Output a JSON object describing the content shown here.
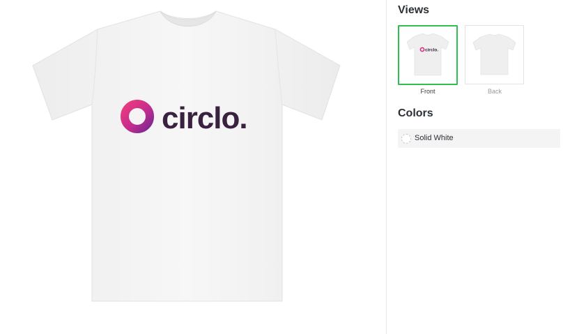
{
  "views": {
    "heading": "Views",
    "items": [
      {
        "label": "Front",
        "selected": true
      },
      {
        "label": "Back",
        "selected": false
      }
    ]
  },
  "colors": {
    "heading": "Colors",
    "options": [
      {
        "name": "Solid White",
        "swatch": "#ffffff",
        "selected": true
      }
    ]
  },
  "product": {
    "logo_text": "circlo.",
    "logo_colors": [
      "#e0357e",
      "#9a2a9e",
      "#3b2140"
    ],
    "shirt_color": "#f5f5f5"
  }
}
